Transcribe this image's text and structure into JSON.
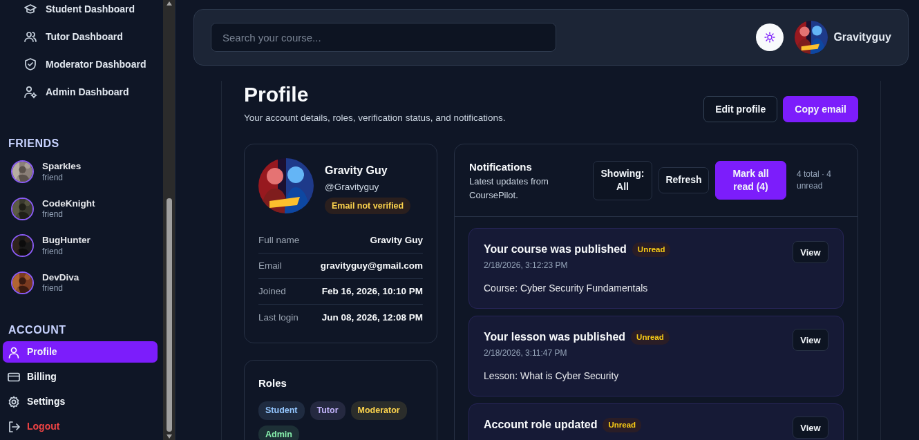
{
  "sidebar": {
    "nav": [
      {
        "label": "Student Dashboard"
      },
      {
        "label": "Tutor Dashboard"
      },
      {
        "label": "Moderator Dashboard"
      },
      {
        "label": "Admin Dashboard"
      }
    ],
    "friends_heading": "FRIENDS",
    "friends": [
      {
        "name": "Sparkles",
        "relation": "friend"
      },
      {
        "name": "CodeKnight",
        "relation": "friend"
      },
      {
        "name": "BugHunter",
        "relation": "friend"
      },
      {
        "name": "DevDiva",
        "relation": "friend"
      }
    ],
    "account_heading": "ACCOUNT",
    "account": [
      {
        "label": "Profile",
        "selected": true,
        "danger": false
      },
      {
        "label": "Billing",
        "selected": false,
        "danger": false
      },
      {
        "label": "Settings",
        "selected": false,
        "danger": false
      },
      {
        "label": "Logout",
        "selected": false,
        "danger": true
      }
    ]
  },
  "header": {
    "search": {
      "placeholder": "Search your course..."
    },
    "username": "Gravityguy"
  },
  "page": {
    "title": "Profile",
    "subtitle": "Your account details, roles, verification status, and notifications.",
    "buttons": [
      {
        "label": "Edit profile",
        "primary": false
      },
      {
        "label": "Copy email",
        "primary": true
      }
    ]
  },
  "profile": {
    "name": "Gravity Guy",
    "handle": "@Gravityguy",
    "verification_badge": "Email not verified",
    "email_verified": false,
    "details": [
      {
        "label": "Full name",
        "value": "Gravity Guy"
      },
      {
        "label": "Email",
        "value": "gravityguy@gmail.com"
      },
      {
        "label": "Joined",
        "value": "Feb 16, 2026, 10:10 PM"
      },
      {
        "label": "Last login",
        "value": "Jun 08, 2026, 12:08 PM"
      }
    ]
  },
  "roles": {
    "title": "Roles",
    "items": [
      {
        "label": "Student",
        "color": "#93c5fd"
      },
      {
        "label": "Tutor",
        "color": "#c4b5fd"
      },
      {
        "label": "Moderator",
        "color": "#fcd34d"
      },
      {
        "label": "Admin",
        "color": "#86efac"
      }
    ]
  },
  "notifications": {
    "title": "Notifications",
    "subtitle": "Latest updates from CoursePilot.",
    "filter_button": "Showing: All",
    "refresh_button": "Refresh",
    "mark_all_button": "Mark all read (4)",
    "summary": "4 total · 4 unread",
    "items": [
      {
        "title": "Your course was published",
        "unread": true,
        "badge": "Unread",
        "time": "2/18/2026, 3:12:23 PM",
        "body": "Course: Cyber Security Fundamentals",
        "action": "View"
      },
      {
        "title": "Your lesson was published",
        "unread": true,
        "badge": "Unread",
        "time": "2/18/2026, 3:11:47 PM",
        "body": "Lesson: What is Cyber Security",
        "action": "View"
      },
      {
        "title": "Account role updated",
        "unread": true,
        "badge": "Unread",
        "action": "View"
      }
    ]
  }
}
